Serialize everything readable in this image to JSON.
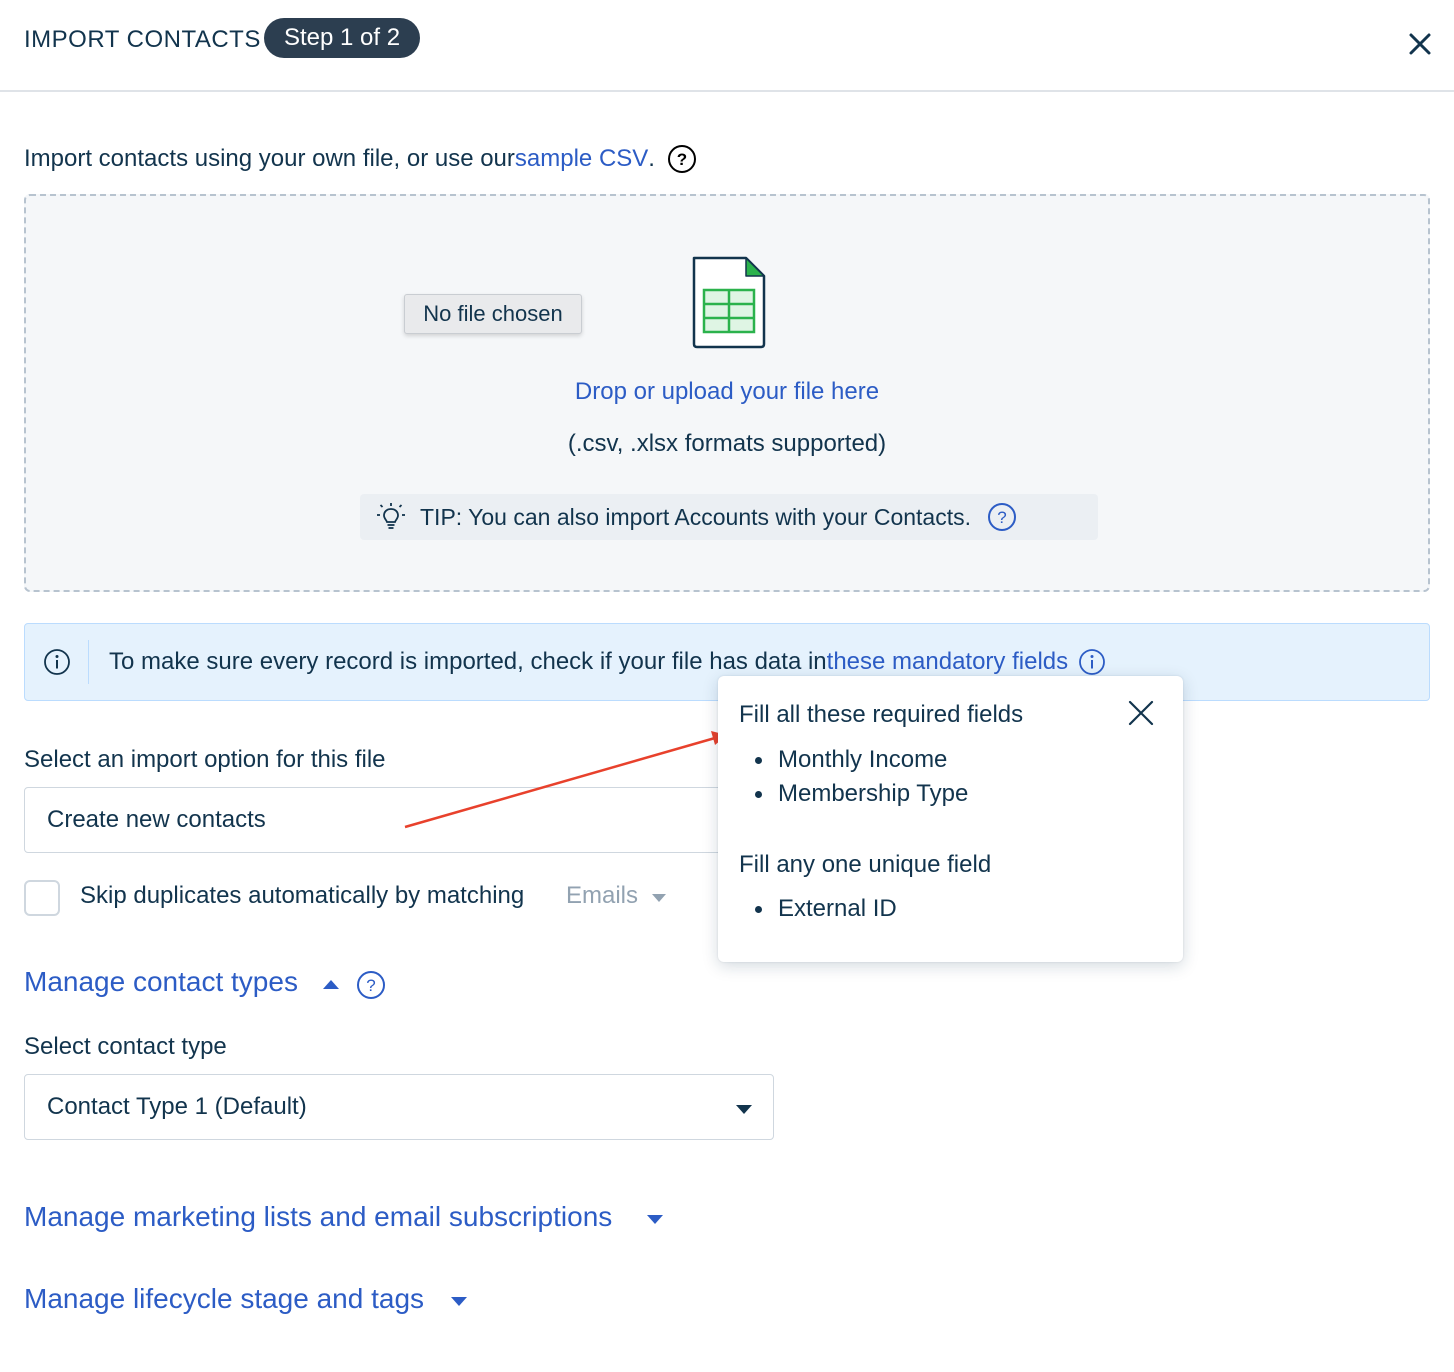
{
  "header": {
    "title": "IMPORT CONTACTS",
    "step": "Step 1 of 2"
  },
  "intro": {
    "text_before": "Import contacts using your own file, or use our ",
    "link": "sample CSV",
    "text_after": "."
  },
  "dropzone": {
    "file_button": "No file chosen",
    "drop_text": "Drop or upload your file here",
    "formats": "(.csv, .xlsx formats supported)",
    "tip": "TIP: You can also import Accounts with your Contacts."
  },
  "info_bar": {
    "text": "To make sure every record is imported, check if your file has data in ",
    "link": "these mandatory fields"
  },
  "import_option": {
    "label": "Select an import option for this file",
    "value": "Create new contacts"
  },
  "skip_duplicates": {
    "label": "Skip duplicates automatically by matching",
    "match_field": "Emails",
    "checked": false
  },
  "contact_types": {
    "link": "Manage contact types",
    "select_label": "Select contact type",
    "selected": "Contact Type 1 (Default)"
  },
  "sections": {
    "marketing": "Manage marketing lists and email subscriptions",
    "lifecycle": "Manage lifecycle stage and tags"
  },
  "popover": {
    "required_heading": "Fill all these required fields",
    "required_fields": [
      "Monthly Income",
      "Membership Type"
    ],
    "unique_heading": "Fill any one unique field",
    "unique_fields": [
      "External ID"
    ]
  },
  "colors": {
    "link": "#2c5cc5",
    "text": "#12344d",
    "pill": "#2c3e50",
    "info_bg": "#e5f2fd",
    "arrow": "#e8412c",
    "file_icon_green": "#2bb24c"
  },
  "icons": {
    "close": "close-icon",
    "help": "question-circle-icon",
    "spreadsheet": "spreadsheet-file-icon",
    "bulb": "lightbulb-icon",
    "info": "info-circle-icon"
  }
}
